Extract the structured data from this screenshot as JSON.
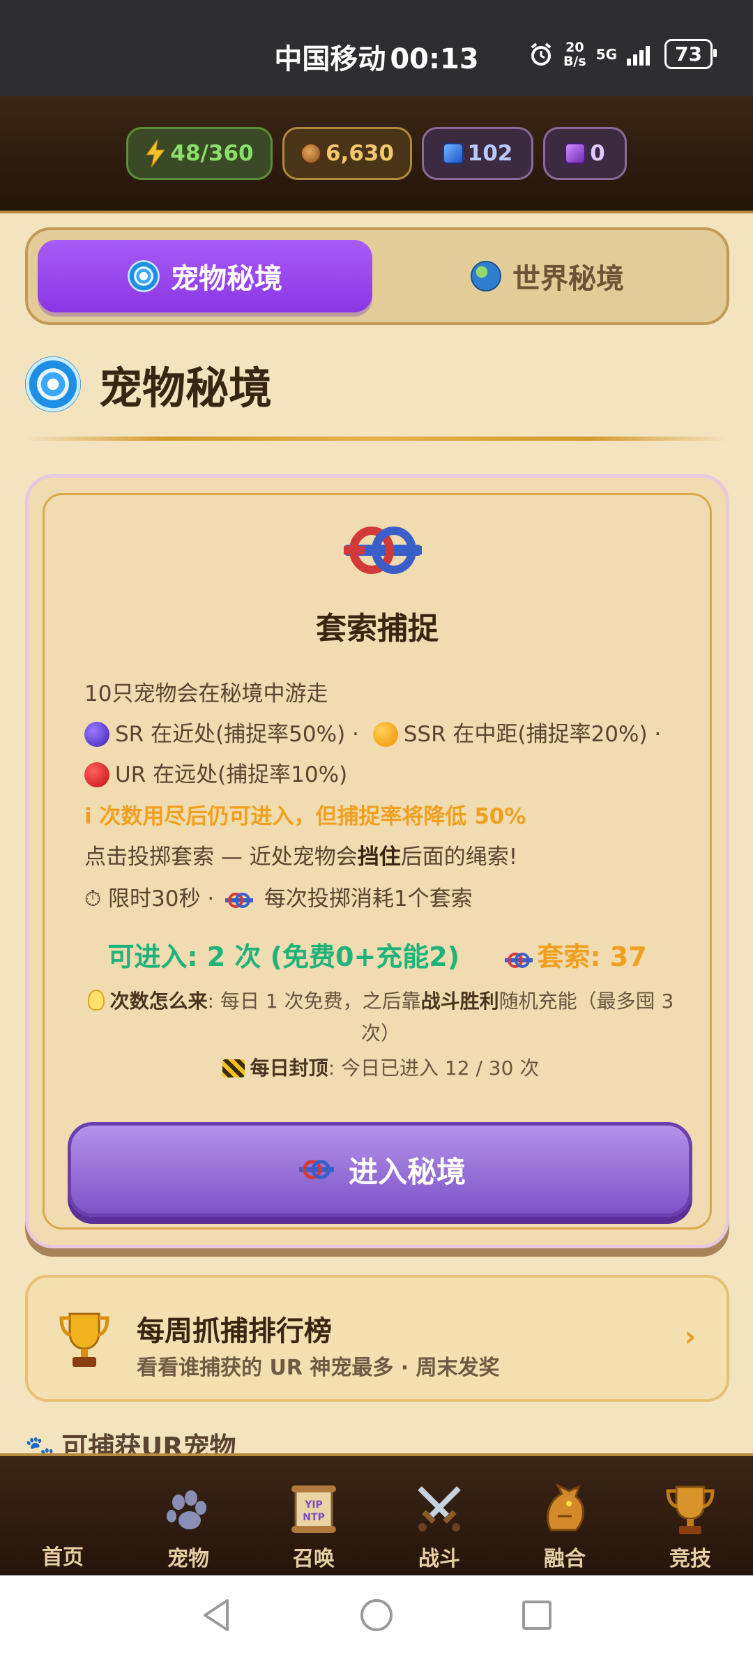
{
  "status_bar": {
    "carrier": "中国移动",
    "time": "00:13",
    "speed_top": "20",
    "speed_bottom": "B/s",
    "network": "5G",
    "battery": "73"
  },
  "resources": {
    "energy": "48/360",
    "gold": "6,630",
    "gems": "102",
    "crystals": "0"
  },
  "tabs": [
    {
      "label": "宠物秘境",
      "active": true
    },
    {
      "label": "世界秘境",
      "active": false
    }
  ],
  "page_title": "宠物秘境",
  "card": {
    "title": "套索捕捉",
    "line1": "10只宠物会在秘境中游走",
    "sr": "SR 在近处(捕捉率50%) ·",
    "ssr": "SSR 在中距(捕捉率20%) ·",
    "ur": "UR 在远处(捕捉率10%)",
    "warning": "i 次数用尽后仍可进入，但捕捉率将降低 50%",
    "tip_pre": "点击投掷套索 — 近处宠物会",
    "tip_bold": "挡住",
    "tip_post": "后面的绳索!",
    "limit_time": "⏱ 限时30秒 ·",
    "limit_cost": "每次投掷消耗1个套索",
    "enter_count": "可进入: 2 次 (免费0+充能2)",
    "rope_count": "套索: 37",
    "hint_label": "次数怎么来",
    "hint_text1": ": 每日 1 次免费，之后靠",
    "hint_bold": "战斗胜利",
    "hint_text2": "随机充能（最多囤 3 次）",
    "cap_label": "每日封顶",
    "cap_text": ": 今日已进入 12 / 30 次",
    "enter_button": "进入秘境"
  },
  "ranking": {
    "title": "每周抓捕排行榜",
    "subtitle": "看看谁捕获的 UR 神宠最多 · 周末发奖",
    "arrow": "›"
  },
  "section_peek": "可捕获UR宠物",
  "bottom_nav": [
    {
      "label": "首页",
      "icon": "home-icon"
    },
    {
      "label": "宠物",
      "icon": "paw-icon"
    },
    {
      "label": "召唤",
      "icon": "scroll-icon"
    },
    {
      "label": "战斗",
      "icon": "crossed-swords-icon"
    },
    {
      "label": "融合",
      "icon": "dragon-icon"
    },
    {
      "label": "竞技",
      "icon": "trophy-icon"
    }
  ],
  "colors": {
    "accent_purple": "#8b35e4",
    "energy_green": "#8be06a",
    "gold": "#f5c76a",
    "warning_orange": "#f0a020",
    "count_green": "#1fb27a"
  }
}
